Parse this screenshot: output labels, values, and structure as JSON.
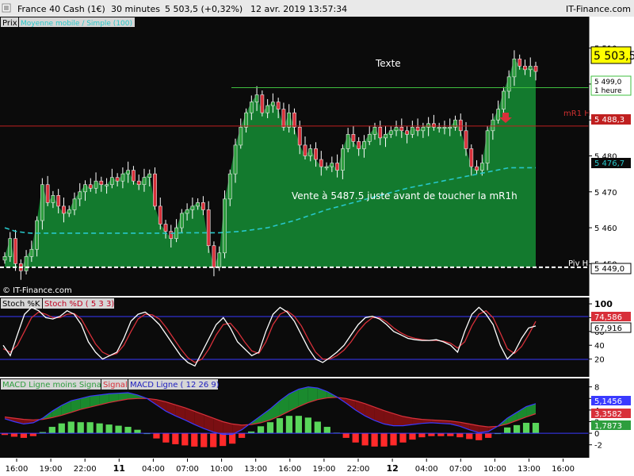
{
  "header": {
    "instrument": "France 40 Cash (1€)",
    "timeframe": "30 minutes",
    "last": "5 503,5 (+0,32%)",
    "datetime": "12 avr. 2019 13:57:34",
    "brand": "IT-Finance.com"
  },
  "price_panel": {
    "tab_label": "Prix",
    "indicator_tab": "Moyenne mobile / Simple (100)",
    "watermark": "© IT-Finance.com",
    "current_price_label": "5 503,5",
    "hline_label": "5 499,0",
    "hline_sub": "1 heure",
    "mr1_label": "mR1 H",
    "mr1_value": "5 488,3",
    "ma_value": "5 476,7",
    "piv_label": "Piv H",
    "piv_value": "5 449,0",
    "y_ticks": [
      "5 510",
      "5 500",
      "5 490",
      "5 480",
      "5 470",
      "5 460",
      "5 450"
    ],
    "annotation_top": "Texte",
    "annotation_main": "Vente à 5487.5 juste avant de toucher la mR1h",
    "colors": {
      "area": "#137a2e",
      "up": "#2e9e3e",
      "down": "#d8303a",
      "ma": "#27c7c9",
      "mr1": "#c02020",
      "hline": "#3fbf3f"
    }
  },
  "stoch_panel": {
    "k_label": "Stoch %K",
    "d_label": "Stoch %D ( 5 3 3)",
    "k_value": "67,916",
    "d_value": "74,586",
    "y_ticks": [
      "100",
      "80",
      "60",
      "40",
      "20"
    ]
  },
  "macd_panel": {
    "hist_label": "MACD Ligne moins Signal",
    "signal_label": "Signal",
    "line_label": "MACD Ligne ( 12 26 9)",
    "line_value": "5,1456",
    "signal_value": "3,3582",
    "hist_value": "1,7873",
    "y_ticks": [
      "8",
      "6",
      "4",
      "2",
      "0",
      "-2"
    ]
  },
  "time_axis": {
    "labels": [
      "16:00",
      "19:00",
      "22:00",
      "11",
      "04:00",
      "07:00",
      "10:00",
      "13:00",
      "16:00",
      "19:00",
      "22:00",
      "12",
      "04:00",
      "07:00",
      "10:00",
      "13:00",
      "16:00"
    ],
    "bold": [
      false,
      false,
      false,
      true,
      false,
      false,
      false,
      false,
      false,
      false,
      false,
      true,
      false,
      false,
      false,
      false,
      false
    ]
  },
  "chart_data": {
    "type": "candlestick",
    "ylim": [
      5445,
      5515
    ],
    "mr1": 5488.3,
    "hline": 5499.0,
    "piv": 5449.0,
    "closes": [
      5452,
      5457,
      5450,
      5448,
      5452,
      5454,
      5462,
      5472,
      5467,
      5469,
      5466,
      5464,
      5465,
      5468,
      5470,
      5472,
      5471,
      5473,
      5472,
      5472,
      5474,
      5473,
      5475,
      5476,
      5473,
      5472,
      5474,
      5475,
      5466,
      5461,
      5459,
      5457,
      5460,
      5464,
      5465,
      5466,
      5467,
      5465,
      5455,
      5449,
      5453,
      5468,
      5475,
      5483,
      5488,
      5492,
      5495,
      5497,
      5492,
      5494,
      5495,
      5493,
      5488,
      5492,
      5488,
      5483,
      5480,
      5482,
      5479,
      5477,
      5477,
      5478,
      5476,
      5482,
      5486,
      5484,
      5482,
      5484,
      5486,
      5488,
      5485,
      5486,
      5487,
      5488,
      5487,
      5486,
      5488,
      5487,
      5488,
      5489,
      5488,
      5488,
      5488,
      5488,
      5490,
      5487,
      5482,
      5477,
      5476,
      5478,
      5487,
      5490,
      5493,
      5498,
      5502,
      5507,
      5505,
      5504,
      5505,
      5503.5
    ],
    "ma": [
      5460,
      5459.5,
      5459,
      5458.8,
      5458.6,
      5458.5,
      5458.5,
      5458.5,
      5458.5,
      5458.5,
      5458.5,
      5458.5,
      5458.5,
      5458.5,
      5458.5,
      5458.5,
      5458.5,
      5458.5,
      5458.5,
      5458.5,
      5458.5,
      5458.5,
      5458.5,
      5458.5,
      5458.5,
      5458.5,
      5458.5,
      5458.5,
      5458.5,
      5458.5,
      5458.5,
      5458.5,
      5458.5,
      5458.6,
      5458.6,
      5458.6,
      5458.6,
      5458.6,
      5458.6,
      5458.6,
      5458.6,
      5458.7,
      5458.8,
      5458.9,
      5459,
      5459.2,
      5459.4,
      5459.6,
      5459.8,
      5460,
      5460.4,
      5460.8,
      5461.2,
      5461.6,
      5462,
      5462.5,
      5463,
      5463.5,
      5464,
      5464.5,
      5465,
      5465.4,
      5465.8,
      5466.2,
      5466.6,
      5467,
      5467.4,
      5467.8,
      5468.2,
      5468.6,
      5469,
      5469.4,
      5469.8,
      5470.2,
      5470.6,
      5471,
      5471.3,
      5471.6,
      5471.9,
      5472.2,
      5472.5,
      5472.8,
      5473.1,
      5473.4,
      5473.7,
      5474,
      5474.3,
      5474.6,
      5474.9,
      5475.2,
      5475.5,
      5475.8,
      5476.1,
      5476.4,
      5476.7,
      5476.7,
      5476.7,
      5476.7,
      5476.7,
      5476.7
    ],
    "stoch_k": [
      40,
      25,
      55,
      85,
      95,
      90,
      80,
      78,
      82,
      90,
      85,
      70,
      45,
      30,
      20,
      25,
      30,
      50,
      75,
      85,
      88,
      80,
      70,
      55,
      40,
      25,
      15,
      10,
      30,
      50,
      70,
      80,
      65,
      45,
      35,
      25,
      30,
      60,
      85,
      95,
      88,
      75,
      55,
      35,
      20,
      15,
      22,
      30,
      40,
      55,
      70,
      80,
      82,
      78,
      70,
      60,
      55,
      50,
      48,
      47,
      47,
      48,
      45,
      40,
      30,
      60,
      85,
      95,
      85,
      70,
      40,
      20,
      30,
      50,
      65,
      67.9
    ],
    "stoch_d": [
      35,
      30,
      40,
      60,
      80,
      88,
      85,
      80,
      80,
      85,
      86,
      78,
      60,
      42,
      30,
      25,
      28,
      40,
      60,
      78,
      85,
      84,
      78,
      65,
      50,
      35,
      22,
      15,
      20,
      35,
      55,
      70,
      72,
      60,
      45,
      32,
      28,
      45,
      70,
      85,
      90,
      82,
      68,
      48,
      30,
      20,
      20,
      25,
      33,
      45,
      60,
      72,
      80,
      80,
      74,
      65,
      58,
      53,
      50,
      48,
      47,
      47,
      46,
      43,
      36,
      45,
      68,
      85,
      90,
      80,
      58,
      35,
      28,
      38,
      55,
      74.6
    ],
    "macd_line": [
      2.5,
      2.0,
      1.6,
      1.8,
      2.6,
      3.8,
      4.8,
      5.6,
      6.0,
      6.4,
      6.6,
      6.8,
      6.9,
      7.0,
      6.6,
      6.0,
      4.9,
      3.8,
      3.0,
      2.3,
      1.5,
      0.8,
      0.2,
      -0.2,
      -0.2,
      0.6,
      1.8,
      3.0,
      4.2,
      5.6,
      6.8,
      7.6,
      8.0,
      7.8,
      7.2,
      6.3,
      5.2,
      4.0,
      3.0,
      2.2,
      1.6,
      1.3,
      1.3,
      1.5,
      1.7,
      1.8,
      1.7,
      1.6,
      1.2,
      0.6,
      0.1,
      0.3,
      1.2,
      2.6,
      3.6,
      4.6,
      5.1
    ],
    "macd_signal": [
      2.8,
      2.6,
      2.4,
      2.3,
      2.4,
      2.7,
      3.1,
      3.6,
      4.1,
      4.5,
      4.9,
      5.3,
      5.6,
      5.9,
      6.0,
      6.0,
      5.8,
      5.4,
      4.9,
      4.4,
      3.8,
      3.2,
      2.6,
      2.0,
      1.6,
      1.4,
      1.5,
      1.8,
      2.3,
      3.0,
      3.8,
      4.6,
      5.3,
      5.8,
      6.1,
      6.2,
      6.0,
      5.6,
      5.1,
      4.5,
      3.9,
      3.4,
      2.9,
      2.6,
      2.4,
      2.3,
      2.2,
      2.1,
      1.9,
      1.6,
      1.3,
      1.1,
      1.2,
      1.6,
      2.2,
      2.8,
      3.36
    ],
    "macd_hist": [
      -0.3,
      -0.6,
      -0.8,
      -0.5,
      0.2,
      1.1,
      1.7,
      2.0,
      1.9,
      1.9,
      1.7,
      1.5,
      1.3,
      1.1,
      0.6,
      0.0,
      -0.9,
      -1.6,
      -1.9,
      -2.1,
      -2.3,
      -2.4,
      -2.4,
      -2.2,
      -1.8,
      -0.8,
      0.3,
      1.2,
      1.9,
      2.6,
      3.0,
      3.0,
      2.7,
      2.0,
      1.1,
      0.1,
      -0.8,
      -1.6,
      -2.1,
      -2.3,
      -2.3,
      -2.1,
      -1.6,
      -1.1,
      -0.7,
      -0.5,
      -0.5,
      -0.5,
      -0.7,
      -1.0,
      -1.2,
      -0.8,
      0.0,
      1.0,
      1.4,
      1.8,
      1.79
    ]
  }
}
